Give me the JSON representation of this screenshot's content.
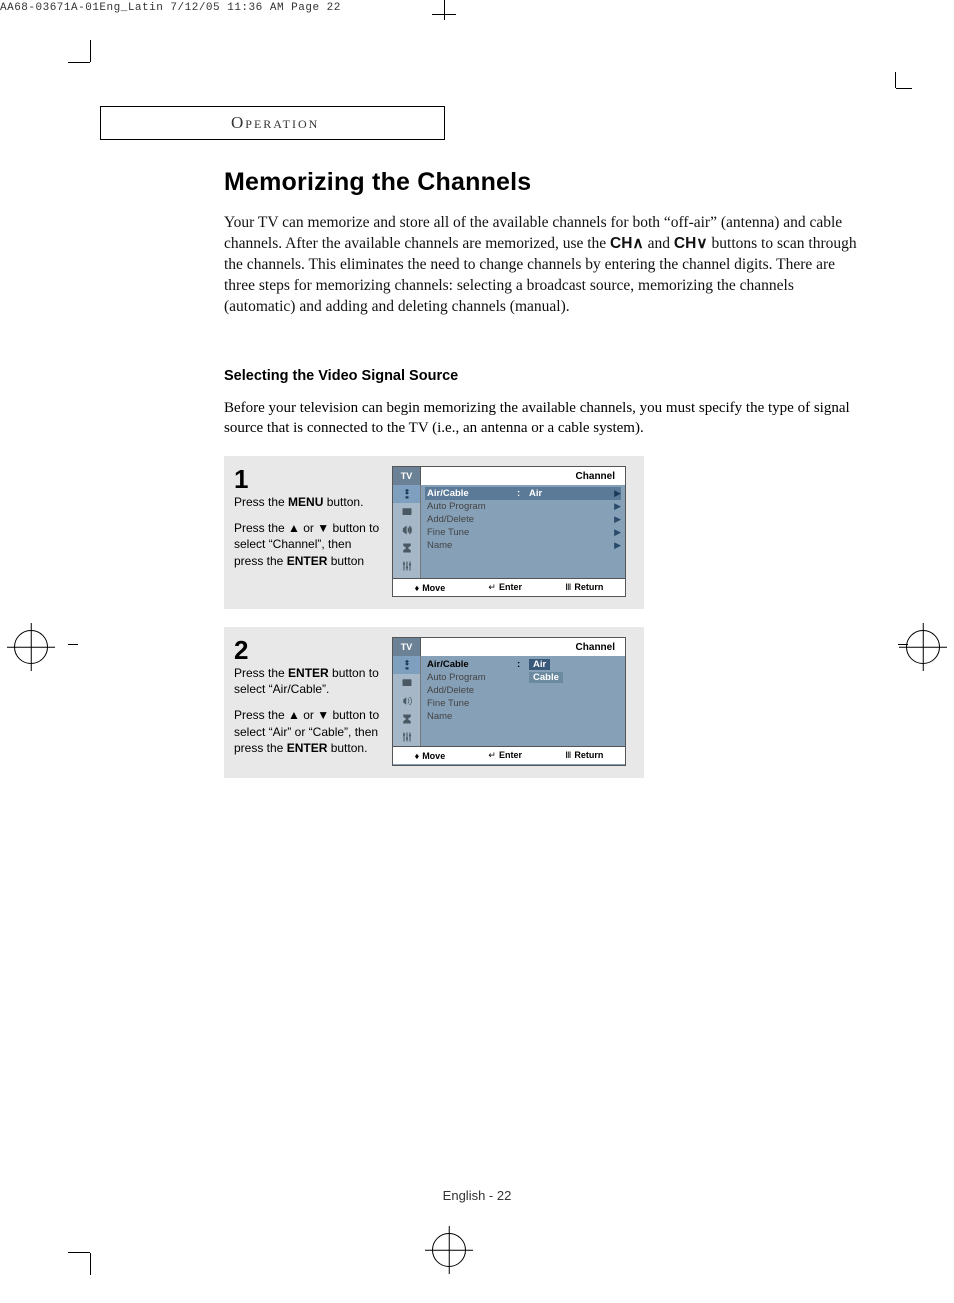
{
  "header_line": "AA68-03671A-01Eng_Latin  7/12/05  11:36 AM  Page 22",
  "section_tab": "Operation",
  "title": "Memorizing the Channels",
  "intro_pre": "Your TV can memorize and store all of the available channels for both “off-air” (antenna) and cable channels. After the available channels are memorized, use the ",
  "ch_up": "CH∧",
  "intro_mid": " and ",
  "ch_down": "CH∨",
  "intro_post": " buttons to scan through the channels. This eliminates the need to change channels by entering the channel digits. There are three steps for memorizing channels: selecting a broadcast source, memorizing the channels (automatic) and adding and deleting channels (manual).",
  "sub_title": "Selecting the Video Signal Source",
  "sub_intro": "Before your television can begin memorizing the available channels, you must specify the type of signal source that is connected to the TV (i.e., an antenna or a cable system).",
  "steps": [
    {
      "num": "1",
      "para1_a": "Press the ",
      "para1_b": "MENU",
      "para1_c": " button.",
      "para2_a": "Press the ▲ or ▼ button to select “Channel”, then press the ",
      "para2_b": "ENTER",
      "para2_c": " button"
    },
    {
      "num": "2",
      "para1_a": "Press the ",
      "para1_b": "ENTER",
      "para1_c": " button to select “Air/Cable”.",
      "para2_a": "Press the ▲ or ▼ button to select “Air” or “Cable”, then press the ",
      "para2_b": "ENTER",
      "para2_c": " button."
    }
  ],
  "menu": {
    "tv": "TV",
    "title": "Channel",
    "items": [
      "Air/Cable",
      "Auto Program",
      "Add/Delete",
      "Fine Tune",
      "Name"
    ],
    "air_value": "Air",
    "cable_value": "Cable",
    "footer": {
      "move": "Move",
      "enter": "Enter",
      "return": "Return"
    }
  },
  "footer_page": "English - 22"
}
